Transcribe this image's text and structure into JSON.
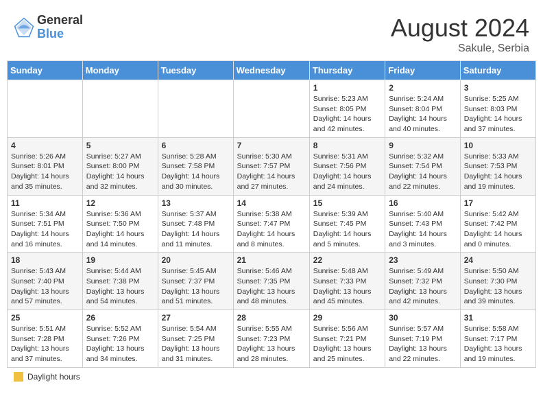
{
  "header": {
    "logo_general": "General",
    "logo_blue": "Blue",
    "month_year": "August 2024",
    "location": "Sakule, Serbia"
  },
  "days_of_week": [
    "Sunday",
    "Monday",
    "Tuesday",
    "Wednesday",
    "Thursday",
    "Friday",
    "Saturday"
  ],
  "footer": {
    "legend_label": "Daylight hours"
  },
  "weeks": [
    {
      "days": [
        {
          "num": "",
          "info": ""
        },
        {
          "num": "",
          "info": ""
        },
        {
          "num": "",
          "info": ""
        },
        {
          "num": "",
          "info": ""
        },
        {
          "num": "1",
          "info": "Sunrise: 5:23 AM\nSunset: 8:05 PM\nDaylight: 14 hours\nand 42 minutes."
        },
        {
          "num": "2",
          "info": "Sunrise: 5:24 AM\nSunset: 8:04 PM\nDaylight: 14 hours\nand 40 minutes."
        },
        {
          "num": "3",
          "info": "Sunrise: 5:25 AM\nSunset: 8:03 PM\nDaylight: 14 hours\nand 37 minutes."
        }
      ]
    },
    {
      "days": [
        {
          "num": "4",
          "info": "Sunrise: 5:26 AM\nSunset: 8:01 PM\nDaylight: 14 hours\nand 35 minutes."
        },
        {
          "num": "5",
          "info": "Sunrise: 5:27 AM\nSunset: 8:00 PM\nDaylight: 14 hours\nand 32 minutes."
        },
        {
          "num": "6",
          "info": "Sunrise: 5:28 AM\nSunset: 7:58 PM\nDaylight: 14 hours\nand 30 minutes."
        },
        {
          "num": "7",
          "info": "Sunrise: 5:30 AM\nSunset: 7:57 PM\nDaylight: 14 hours\nand 27 minutes."
        },
        {
          "num": "8",
          "info": "Sunrise: 5:31 AM\nSunset: 7:56 PM\nDaylight: 14 hours\nand 24 minutes."
        },
        {
          "num": "9",
          "info": "Sunrise: 5:32 AM\nSunset: 7:54 PM\nDaylight: 14 hours\nand 22 minutes."
        },
        {
          "num": "10",
          "info": "Sunrise: 5:33 AM\nSunset: 7:53 PM\nDaylight: 14 hours\nand 19 minutes."
        }
      ]
    },
    {
      "days": [
        {
          "num": "11",
          "info": "Sunrise: 5:34 AM\nSunset: 7:51 PM\nDaylight: 14 hours\nand 16 minutes."
        },
        {
          "num": "12",
          "info": "Sunrise: 5:36 AM\nSunset: 7:50 PM\nDaylight: 14 hours\nand 14 minutes."
        },
        {
          "num": "13",
          "info": "Sunrise: 5:37 AM\nSunset: 7:48 PM\nDaylight: 14 hours\nand 11 minutes."
        },
        {
          "num": "14",
          "info": "Sunrise: 5:38 AM\nSunset: 7:47 PM\nDaylight: 14 hours\nand 8 minutes."
        },
        {
          "num": "15",
          "info": "Sunrise: 5:39 AM\nSunset: 7:45 PM\nDaylight: 14 hours\nand 5 minutes."
        },
        {
          "num": "16",
          "info": "Sunrise: 5:40 AM\nSunset: 7:43 PM\nDaylight: 14 hours\nand 3 minutes."
        },
        {
          "num": "17",
          "info": "Sunrise: 5:42 AM\nSunset: 7:42 PM\nDaylight: 14 hours\nand 0 minutes."
        }
      ]
    },
    {
      "days": [
        {
          "num": "18",
          "info": "Sunrise: 5:43 AM\nSunset: 7:40 PM\nDaylight: 13 hours\nand 57 minutes."
        },
        {
          "num": "19",
          "info": "Sunrise: 5:44 AM\nSunset: 7:38 PM\nDaylight: 13 hours\nand 54 minutes."
        },
        {
          "num": "20",
          "info": "Sunrise: 5:45 AM\nSunset: 7:37 PM\nDaylight: 13 hours\nand 51 minutes."
        },
        {
          "num": "21",
          "info": "Sunrise: 5:46 AM\nSunset: 7:35 PM\nDaylight: 13 hours\nand 48 minutes."
        },
        {
          "num": "22",
          "info": "Sunrise: 5:48 AM\nSunset: 7:33 PM\nDaylight: 13 hours\nand 45 minutes."
        },
        {
          "num": "23",
          "info": "Sunrise: 5:49 AM\nSunset: 7:32 PM\nDaylight: 13 hours\nand 42 minutes."
        },
        {
          "num": "24",
          "info": "Sunrise: 5:50 AM\nSunset: 7:30 PM\nDaylight: 13 hours\nand 39 minutes."
        }
      ]
    },
    {
      "days": [
        {
          "num": "25",
          "info": "Sunrise: 5:51 AM\nSunset: 7:28 PM\nDaylight: 13 hours\nand 37 minutes."
        },
        {
          "num": "26",
          "info": "Sunrise: 5:52 AM\nSunset: 7:26 PM\nDaylight: 13 hours\nand 34 minutes."
        },
        {
          "num": "27",
          "info": "Sunrise: 5:54 AM\nSunset: 7:25 PM\nDaylight: 13 hours\nand 31 minutes."
        },
        {
          "num": "28",
          "info": "Sunrise: 5:55 AM\nSunset: 7:23 PM\nDaylight: 13 hours\nand 28 minutes."
        },
        {
          "num": "29",
          "info": "Sunrise: 5:56 AM\nSunset: 7:21 PM\nDaylight: 13 hours\nand 25 minutes."
        },
        {
          "num": "30",
          "info": "Sunrise: 5:57 AM\nSunset: 7:19 PM\nDaylight: 13 hours\nand 22 minutes."
        },
        {
          "num": "31",
          "info": "Sunrise: 5:58 AM\nSunset: 7:17 PM\nDaylight: 13 hours\nand 19 minutes."
        }
      ]
    }
  ]
}
